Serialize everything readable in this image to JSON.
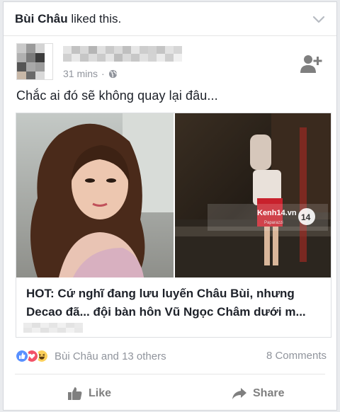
{
  "header": {
    "liker_name": "Bùi Châu",
    "liked_suffix": " liked this."
  },
  "post": {
    "time": "31 mins",
    "separator": "·",
    "privacy_icon": "globe-icon",
    "text": "Chắc ai đó sẽ không quay lại đâu..."
  },
  "link": {
    "title": "HOT: Cứ nghĩ đang lưu luyến Châu Bùi, nhưng Decao đã... đội bàn hôn Vũ Ngọc Châm dưới m...",
    "watermark_site": "Kenh14.vn",
    "watermark_sub": "Paparazzi",
    "watermark_badge": "14"
  },
  "reactions": {
    "icons": [
      "like-icon",
      "love-icon",
      "haha-icon"
    ],
    "label": "Bùi Châu and 13 others",
    "comments": "8 Comments"
  },
  "actions": {
    "like_label": "Like",
    "share_label": "Share"
  },
  "colors": {
    "like_blue": "#5890ff",
    "love_red": "#f25268",
    "haha_yellow": "#fcd05b",
    "muted_text": "#90949c"
  }
}
